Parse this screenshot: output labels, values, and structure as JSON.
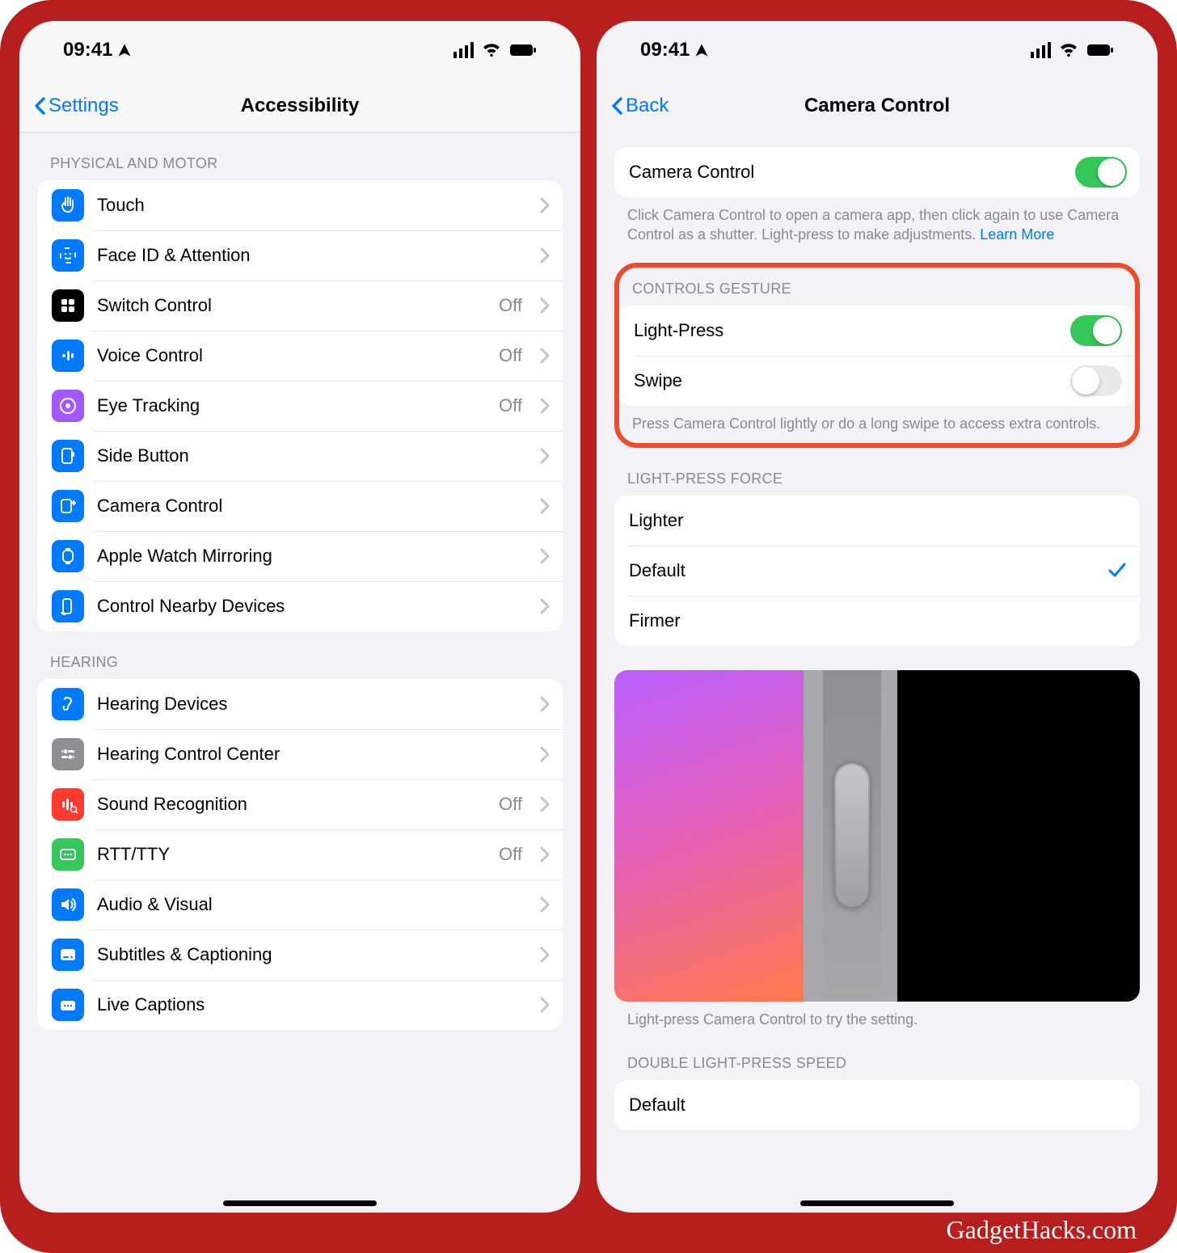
{
  "watermark": "GadgetHacks.com",
  "statusbar": {
    "time": "09:41"
  },
  "left": {
    "back": "Settings",
    "title": "Accessibility",
    "sections": [
      {
        "header": "PHYSICAL AND MOTOR",
        "rows": [
          {
            "label": "Touch",
            "value": "",
            "icon": "hand",
            "bg": "bg-blue"
          },
          {
            "label": "Face ID & Attention",
            "value": "",
            "icon": "faceid",
            "bg": "bg-blue"
          },
          {
            "label": "Switch Control",
            "value": "Off",
            "icon": "grid",
            "bg": "bg-black"
          },
          {
            "label": "Voice Control",
            "value": "Off",
            "icon": "voice",
            "bg": "bg-blue"
          },
          {
            "label": "Eye Tracking",
            "value": "Off",
            "icon": "eye",
            "bg": "bg-purple"
          },
          {
            "label": "Side Button",
            "value": "",
            "icon": "sidebtn",
            "bg": "bg-blue"
          },
          {
            "label": "Camera Control",
            "value": "",
            "icon": "camctl",
            "bg": "bg-blue"
          },
          {
            "label": "Apple Watch Mirroring",
            "value": "",
            "icon": "watch",
            "bg": "bg-blue"
          },
          {
            "label": "Control Nearby Devices",
            "value": "",
            "icon": "nearby",
            "bg": "bg-blue"
          }
        ]
      },
      {
        "header": "HEARING",
        "rows": [
          {
            "label": "Hearing Devices",
            "value": "",
            "icon": "ear",
            "bg": "bg-blue"
          },
          {
            "label": "Hearing Control Center",
            "value": "",
            "icon": "sliders",
            "bg": "bg-gray"
          },
          {
            "label": "Sound Recognition",
            "value": "Off",
            "icon": "soundrec",
            "bg": "bg-red"
          },
          {
            "label": "RTT/TTY",
            "value": "Off",
            "icon": "rtt",
            "bg": "bg-green"
          },
          {
            "label": "Audio & Visual",
            "value": "",
            "icon": "speaker",
            "bg": "bg-blue"
          },
          {
            "label": "Subtitles & Captioning",
            "value": "",
            "icon": "subs",
            "bg": "bg-blue"
          },
          {
            "label": "Live Captions",
            "value": "",
            "icon": "livecap",
            "bg": "bg-blue"
          }
        ]
      }
    ]
  },
  "right": {
    "back": "Back",
    "title": "Camera Control",
    "main_toggle": {
      "label": "Camera Control",
      "on": true
    },
    "main_footer": "Click Camera Control to open a camera app, then click again to use Camera Control as a shutter. Light-press to make adjustments. ",
    "main_footer_link": "Learn More",
    "gesture_header": "CONTROLS GESTURE",
    "gesture_rows": [
      {
        "label": "Light-Press",
        "on": true
      },
      {
        "label": "Swipe",
        "on": false
      }
    ],
    "gesture_footer": "Press Camera Control lightly or do a long swipe to access extra controls.",
    "force_header": "LIGHT-PRESS FORCE",
    "force_options": [
      {
        "label": "Lighter",
        "selected": false
      },
      {
        "label": "Default",
        "selected": true
      },
      {
        "label": "Firmer",
        "selected": false
      }
    ],
    "preview_footer": "Light-press Camera Control to try the setting.",
    "dbl_header": "DOUBLE LIGHT-PRESS SPEED",
    "dbl_row": {
      "label": "Default"
    }
  }
}
